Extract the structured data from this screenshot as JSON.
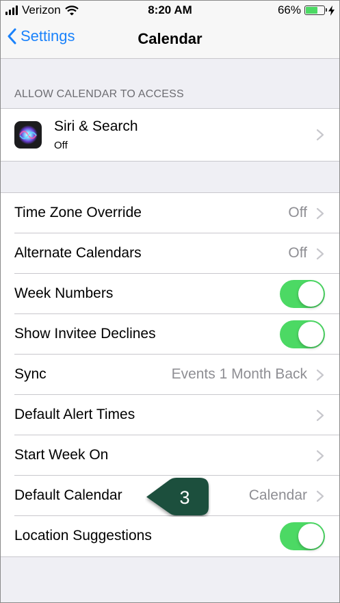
{
  "status_bar": {
    "carrier": "Verizon",
    "time": "8:20 AM",
    "battery_percent": "66%",
    "battery_level": 0.66
  },
  "nav": {
    "back_label": "Settings",
    "title": "Calendar"
  },
  "access_section": {
    "header": "ALLOW CALENDAR TO ACCESS",
    "siri": {
      "title": "Siri & Search",
      "subtitle": "Off"
    }
  },
  "settings": {
    "time_zone": {
      "label": "Time Zone Override",
      "value": "Off"
    },
    "alternate": {
      "label": "Alternate Calendars",
      "value": "Off"
    },
    "week_numbers": {
      "label": "Week Numbers",
      "on": true
    },
    "invitee_declines": {
      "label": "Show Invitee Declines",
      "on": true
    },
    "sync": {
      "label": "Sync",
      "value": "Events 1 Month Back"
    },
    "alert_times": {
      "label": "Default Alert Times"
    },
    "start_week": {
      "label": "Start Week On"
    },
    "default_calendar": {
      "label": "Default Calendar",
      "value": "Calendar"
    },
    "location_suggestions": {
      "label": "Location Suggestions",
      "on": true
    }
  },
  "callout": {
    "number": "3"
  },
  "colors": {
    "accent": "#1a82fb",
    "toggle_on": "#4cd964",
    "callout": "#1f4f3e"
  }
}
